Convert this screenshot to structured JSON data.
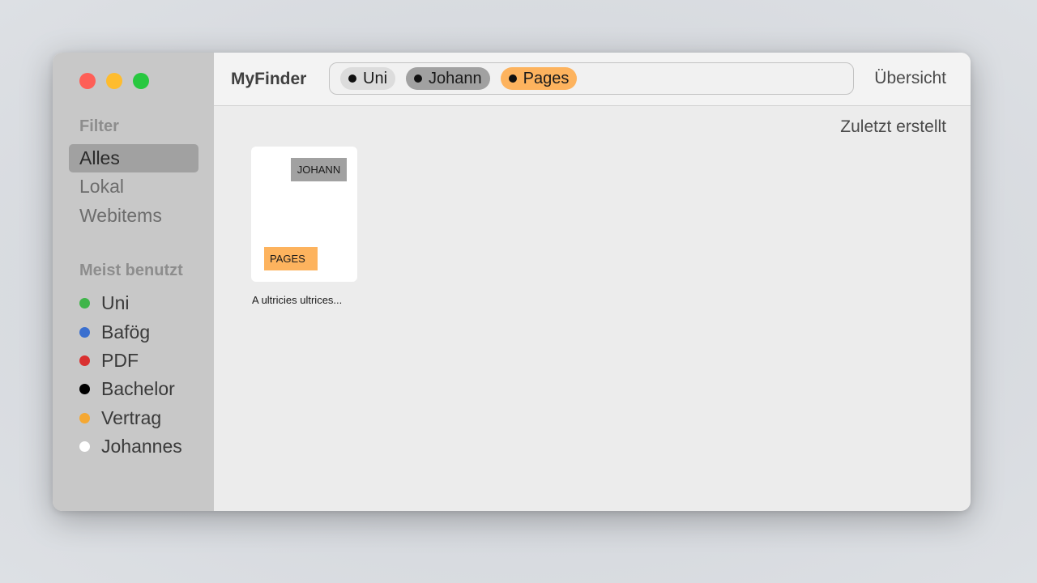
{
  "colors": {
    "close": "#fe5f57",
    "minimize": "#febc2e",
    "zoom": "#28c840",
    "sidebar_bg": "#c8c8c8",
    "active_item_bg": "#a1a1a1",
    "orange": "#fdb35e",
    "gray_tag": "#a1a1a1",
    "light_token": "#dcdcdc"
  },
  "toolbar": {
    "app_title": "MyFinder",
    "overview_label": "Übersicht",
    "search_tokens": [
      {
        "label": "Uni",
        "color": "#dcdcdc"
      },
      {
        "label": "Johann",
        "color": "#a1a1a1"
      },
      {
        "label": "Pages",
        "color": "#fdb35e"
      }
    ]
  },
  "sidebar": {
    "filter_heading": "Filter",
    "filter_items": [
      {
        "label": "Alles",
        "active": true
      },
      {
        "label": "Lokal",
        "active": false
      },
      {
        "label": "Webitems",
        "active": false
      }
    ],
    "most_used_heading": "Meist benutzt",
    "tags": [
      {
        "label": "Uni",
        "color": "#3fb54a"
      },
      {
        "label": "Bafög",
        "color": "#3a6fcf"
      },
      {
        "label": "PDF",
        "color": "#d93030"
      },
      {
        "label": "Bachelor",
        "color": "#000000"
      },
      {
        "label": "Vertrag",
        "color": "#f5a833"
      },
      {
        "label": "Johannes",
        "color": "#ffffff"
      }
    ]
  },
  "main": {
    "sort_label": "Zuletzt erstellt",
    "files": [
      {
        "name": "A ultricies ultrices...",
        "tag_top": "JOHANN",
        "tag_top_color": "#a1a1a1",
        "tag_bottom": "PAGES",
        "tag_bottom_color": "#fdb35e"
      }
    ]
  }
}
